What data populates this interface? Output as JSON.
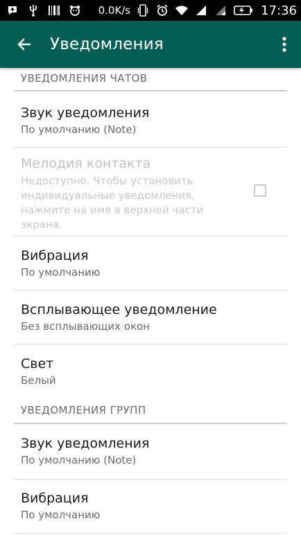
{
  "status_bar": {
    "speed": "0.0K/s",
    "time": "17:36",
    "icons_left": [
      "notification-plus-icon",
      "usb-icon",
      "barcode-icon",
      "android-icon"
    ],
    "icons_right": [
      "vibrate-icon",
      "alarm-icon",
      "wifi-icon",
      "signal-icon",
      "signal-icon-2",
      "battery-icon"
    ]
  },
  "app_bar": {
    "title": "Уведомления",
    "background": "#075e54"
  },
  "sections": {
    "chats_header": "УВЕДОМЛЕНИЯ ЧАТОВ",
    "groups_header": "УВЕДОМЛЕНИЯ ГРУПП"
  },
  "chats": {
    "sound": {
      "title": "Звук уведомления",
      "value": "По умолчанию (Note)"
    },
    "contact_tone": {
      "title": "Мелодия контакта",
      "description": "Недоступно. Чтобы установить индивидуальные уведомления, нажмите на имя в верхней части экрана.",
      "checked": false
    },
    "vibration": {
      "title": "Вибрация",
      "value": "По умолчанию"
    },
    "popup": {
      "title": "Всплывающее уведомление",
      "value": "Без всплывающих окон"
    },
    "light": {
      "title": "Свет",
      "value": "Белый"
    }
  },
  "groups": {
    "sound": {
      "title": "Звук уведомления",
      "value": "По умолчанию (Note)"
    },
    "vibration": {
      "title": "Вибрация",
      "value": "По умолчанию"
    }
  }
}
